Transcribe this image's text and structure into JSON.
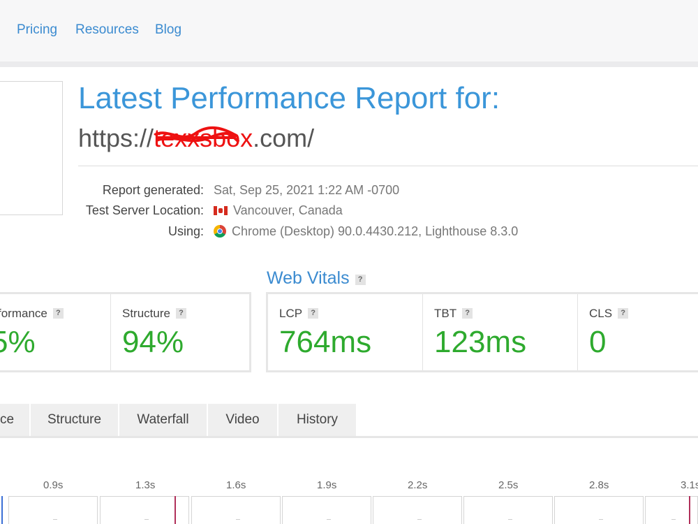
{
  "nav": {
    "items": [
      "Pricing",
      "Resources",
      "Blog"
    ]
  },
  "report": {
    "title": "Latest Performance Report for:",
    "url_prefix": "https://",
    "url_redacted": "texxsbox",
    "url_suffix": ".com/",
    "meta": [
      {
        "label": "Report generated:",
        "value": "Sat, Sep 25, 2021 1:22 AM -0700",
        "icon": ""
      },
      {
        "label": "Test Server Location:",
        "value": "Vancouver, Canada",
        "icon": "canada-flag-icon"
      },
      {
        "label": "Using:",
        "value": "Chrome (Desktop) 90.0.4430.212, Lighthouse 8.3.0",
        "icon": "chrome-icon"
      }
    ]
  },
  "grades": [
    {
      "label": "formance",
      "value": "5%"
    },
    {
      "label": "Structure",
      "value": "94%"
    }
  ],
  "web_vitals": {
    "title": "Web Vitals",
    "items": [
      {
        "label": "LCP",
        "value": "764ms"
      },
      {
        "label": "TBT",
        "value": "123ms"
      },
      {
        "label": "CLS",
        "value": "0"
      }
    ]
  },
  "help_badge": "?",
  "tabs": [
    "ce",
    "Structure",
    "Waterfall",
    "Video",
    "History"
  ],
  "timeline": {
    "ticks": [
      "0.9s",
      "1.3s",
      "1.6s",
      "1.9s",
      "2.2s",
      "2.5s",
      "2.8s",
      "3.1s"
    ]
  },
  "colors": {
    "accent": "#3b8bd0",
    "good": "#2eaa2e",
    "marker_blue": "#3b6fd6",
    "marker_red": "#b0305a"
  }
}
